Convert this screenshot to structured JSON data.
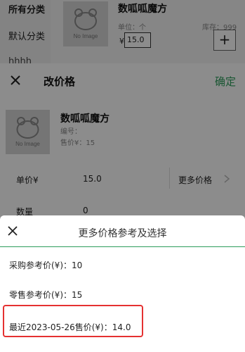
{
  "background_list": {
    "categories": [
      "所有分类",
      "默认分类",
      "hhhh"
    ],
    "product": {
      "name": "数呱呱魔方",
      "no_image": "No Image",
      "unit": "单位：个",
      "stock": "库存：999",
      "currency": "¥",
      "qty_value": "15.0",
      "plus": "+"
    }
  },
  "edit_price": {
    "title": "改价格",
    "confirm": "确定",
    "product": {
      "name": "数呱呱魔方",
      "no_image": "No Image",
      "code": "编号：",
      "sale_price": "售价¥：15"
    },
    "price_label": "单价¥",
    "price_value": "15.0",
    "more_price": "更多价格",
    "qty_label": "数量",
    "qty_value": "0"
  },
  "sheet": {
    "title": "更多价格参考及选择",
    "options": [
      "采购参考价(¥)：10",
      "零售参考价(¥)：15",
      "最近2023-05-26售价(¥)：14.0"
    ]
  },
  "colors": {
    "accent": "#2e9d5c",
    "highlight": "#e53131"
  }
}
